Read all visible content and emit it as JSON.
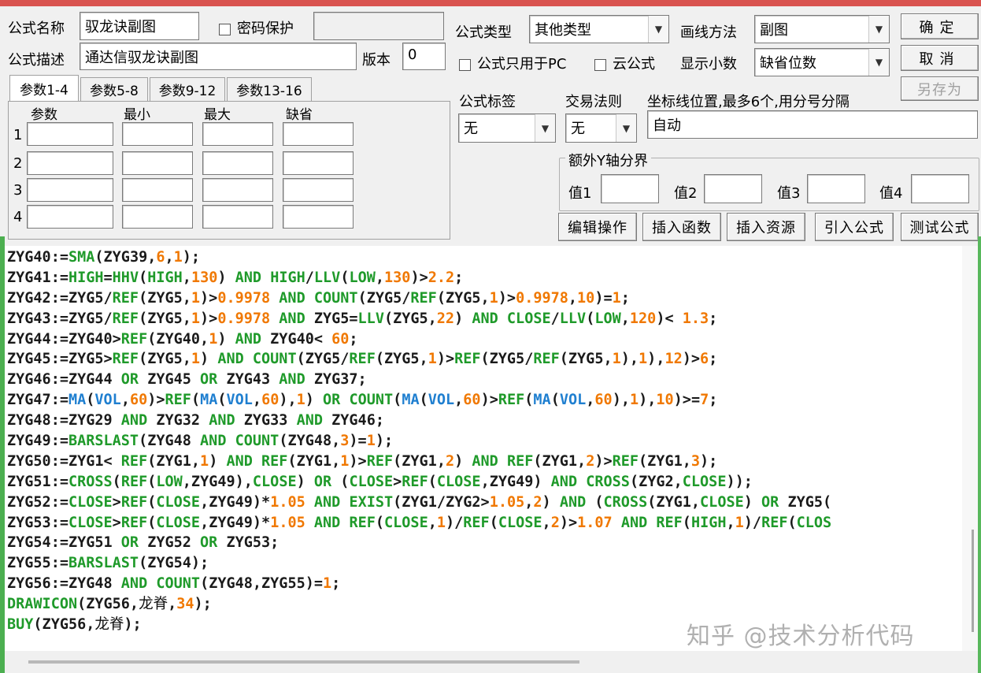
{
  "formula": {
    "name_label": "公式名称",
    "name_value": "驭龙诀副图",
    "password_label": "密码保护",
    "desc_label": "公式描述",
    "desc_value": "通达信驭龙诀副图",
    "version_label": "版本",
    "version_value": "0",
    "type_label": "公式类型",
    "type_value": "其他类型",
    "draw_label": "画线方法",
    "draw_value": "副图",
    "pc_only_label": "公式只用于PC",
    "cloud_label": "云公式",
    "decimals_label": "显示小数",
    "decimals_value": "缺省位数",
    "tag_label": "公式标签",
    "tag_value": "无",
    "rule_label": "交易法则",
    "rule_value": "无",
    "axis_label": "坐标线位置,最多6个,用分号分隔",
    "axis_value": "自动",
    "extra_y_label": "额外Y轴分界",
    "val1": "值1",
    "val2": "值2",
    "val3": "值3",
    "val4": "值4"
  },
  "buttons": {
    "ok": "确定",
    "cancel": "取消",
    "save_as": "另存为",
    "edit_ops": "编辑操作",
    "insert_fn": "插入函数",
    "insert_res": "插入资源",
    "import": "引入公式",
    "test": "测试公式"
  },
  "tabs": [
    "参数1-4",
    "参数5-8",
    "参数9-12",
    "参数13-16"
  ],
  "params": {
    "headers": [
      "参数",
      "最小",
      "最大",
      "缺省"
    ],
    "rows": [
      "1",
      "2",
      "3",
      "4"
    ]
  },
  "code_lines": [
    [
      [
        "t",
        "ZYG40:="
      ],
      [
        "f",
        "SMA"
      ],
      [
        "t",
        "(ZYG39,"
      ],
      [
        "n",
        "6"
      ],
      [
        "t",
        ","
      ],
      [
        "n",
        "1"
      ],
      [
        "t",
        ");"
      ]
    ],
    [
      [
        "t",
        "ZYG41:="
      ],
      [
        "f",
        "HIGH"
      ],
      [
        "t",
        "="
      ],
      [
        "f",
        "HHV"
      ],
      [
        "t",
        "("
      ],
      [
        "f",
        "HIGH"
      ],
      [
        "t",
        ","
      ],
      [
        "n",
        "130"
      ],
      [
        "t",
        ") "
      ],
      [
        "f",
        "AND"
      ],
      [
        "t",
        " "
      ],
      [
        "f",
        "HIGH"
      ],
      [
        "t",
        "/"
      ],
      [
        "f",
        "LLV"
      ],
      [
        "t",
        "("
      ],
      [
        "f",
        "LOW"
      ],
      [
        "t",
        ","
      ],
      [
        "n",
        "130"
      ],
      [
        "t",
        ")>"
      ],
      [
        "n",
        "2.2"
      ],
      [
        "t",
        ";"
      ]
    ],
    [
      [
        "t",
        "ZYG42:=ZYG5/"
      ],
      [
        "f",
        "REF"
      ],
      [
        "t",
        "(ZYG5,"
      ],
      [
        "n",
        "1"
      ],
      [
        "t",
        ")>"
      ],
      [
        "n",
        "0.9978"
      ],
      [
        "t",
        " "
      ],
      [
        "f",
        "AND"
      ],
      [
        "t",
        " "
      ],
      [
        "f",
        "COUNT"
      ],
      [
        "t",
        "(ZYG5/"
      ],
      [
        "f",
        "REF"
      ],
      [
        "t",
        "(ZYG5,"
      ],
      [
        "n",
        "1"
      ],
      [
        "t",
        ")>"
      ],
      [
        "n",
        "0.9978"
      ],
      [
        "t",
        ","
      ],
      [
        "n",
        "10"
      ],
      [
        "t",
        ")="
      ],
      [
        "n",
        "1"
      ],
      [
        "t",
        ";"
      ]
    ],
    [
      [
        "t",
        "ZYG43:=ZYG5/"
      ],
      [
        "f",
        "REF"
      ],
      [
        "t",
        "(ZYG5,"
      ],
      [
        "n",
        "1"
      ],
      [
        "t",
        ")>"
      ],
      [
        "n",
        "0.9978"
      ],
      [
        "t",
        " "
      ],
      [
        "f",
        "AND"
      ],
      [
        "t",
        " ZYG5="
      ],
      [
        "f",
        "LLV"
      ],
      [
        "t",
        "(ZYG5,"
      ],
      [
        "n",
        "22"
      ],
      [
        "t",
        ") "
      ],
      [
        "f",
        "AND"
      ],
      [
        "t",
        " "
      ],
      [
        "f",
        "CLOSE"
      ],
      [
        "t",
        "/"
      ],
      [
        "f",
        "LLV"
      ],
      [
        "t",
        "("
      ],
      [
        "f",
        "LOW"
      ],
      [
        "t",
        ","
      ],
      [
        "n",
        "120"
      ],
      [
        "t",
        ")< "
      ],
      [
        "n",
        "1.3"
      ],
      [
        "t",
        ";"
      ]
    ],
    [
      [
        "t",
        "ZYG44:=ZYG40>"
      ],
      [
        "f",
        "REF"
      ],
      [
        "t",
        "(ZYG40,"
      ],
      [
        "n",
        "1"
      ],
      [
        "t",
        ") "
      ],
      [
        "f",
        "AND"
      ],
      [
        "t",
        " ZYG40< "
      ],
      [
        "n",
        "60"
      ],
      [
        "t",
        ";"
      ]
    ],
    [
      [
        "t",
        "ZYG45:=ZYG5>"
      ],
      [
        "f",
        "REF"
      ],
      [
        "t",
        "(ZYG5,"
      ],
      [
        "n",
        "1"
      ],
      [
        "t",
        ") "
      ],
      [
        "f",
        "AND"
      ],
      [
        "t",
        " "
      ],
      [
        "f",
        "COUNT"
      ],
      [
        "t",
        "(ZYG5/"
      ],
      [
        "f",
        "REF"
      ],
      [
        "t",
        "(ZYG5,"
      ],
      [
        "n",
        "1"
      ],
      [
        "t",
        ")>"
      ],
      [
        "f",
        "REF"
      ],
      [
        "t",
        "(ZYG5/"
      ],
      [
        "f",
        "REF"
      ],
      [
        "t",
        "(ZYG5,"
      ],
      [
        "n",
        "1"
      ],
      [
        "t",
        "),"
      ],
      [
        "n",
        "1"
      ],
      [
        "t",
        "),"
      ],
      [
        "n",
        "12"
      ],
      [
        "t",
        ")>"
      ],
      [
        "n",
        "6"
      ],
      [
        "t",
        ";"
      ]
    ],
    [
      [
        "t",
        "ZYG46:=ZYG44 "
      ],
      [
        "f",
        "OR"
      ],
      [
        "t",
        " ZYG45 "
      ],
      [
        "f",
        "OR"
      ],
      [
        "t",
        " ZYG43 "
      ],
      [
        "f",
        "AND"
      ],
      [
        "t",
        " ZYG37;"
      ]
    ],
    [
      [
        "t",
        "ZYG47:="
      ],
      [
        "b",
        "MA"
      ],
      [
        "t",
        "("
      ],
      [
        "b",
        "VOL"
      ],
      [
        "t",
        ","
      ],
      [
        "n",
        "60"
      ],
      [
        "t",
        ")>"
      ],
      [
        "f",
        "REF"
      ],
      [
        "t",
        "("
      ],
      [
        "b",
        "MA"
      ],
      [
        "t",
        "("
      ],
      [
        "b",
        "VOL"
      ],
      [
        "t",
        ","
      ],
      [
        "n",
        "60"
      ],
      [
        "t",
        "),"
      ],
      [
        "n",
        "1"
      ],
      [
        "t",
        ") "
      ],
      [
        "f",
        "OR"
      ],
      [
        "t",
        " "
      ],
      [
        "f",
        "COUNT"
      ],
      [
        "t",
        "("
      ],
      [
        "b",
        "MA"
      ],
      [
        "t",
        "("
      ],
      [
        "b",
        "VOL"
      ],
      [
        "t",
        ","
      ],
      [
        "n",
        "60"
      ],
      [
        "t",
        ")>"
      ],
      [
        "f",
        "REF"
      ],
      [
        "t",
        "("
      ],
      [
        "b",
        "MA"
      ],
      [
        "t",
        "("
      ],
      [
        "b",
        "VOL"
      ],
      [
        "t",
        ","
      ],
      [
        "n",
        "60"
      ],
      [
        "t",
        "),"
      ],
      [
        "n",
        "1"
      ],
      [
        "t",
        "),"
      ],
      [
        "n",
        "10"
      ],
      [
        "t",
        ")>="
      ],
      [
        "n",
        "7"
      ],
      [
        "t",
        ";"
      ]
    ],
    [
      [
        "t",
        "ZYG48:=ZYG29 "
      ],
      [
        "f",
        "AND"
      ],
      [
        "t",
        " ZYG32 "
      ],
      [
        "f",
        "AND"
      ],
      [
        "t",
        " ZYG33 "
      ],
      [
        "f",
        "AND"
      ],
      [
        "t",
        " ZYG46;"
      ]
    ],
    [
      [
        "t",
        "ZYG49:="
      ],
      [
        "f",
        "BARSLAST"
      ],
      [
        "t",
        "(ZYG48 "
      ],
      [
        "f",
        "AND"
      ],
      [
        "t",
        " "
      ],
      [
        "f",
        "COUNT"
      ],
      [
        "t",
        "(ZYG48,"
      ],
      [
        "n",
        "3"
      ],
      [
        "t",
        ")="
      ],
      [
        "n",
        "1"
      ],
      [
        "t",
        ");"
      ]
    ],
    [
      [
        "t",
        "ZYG50:=ZYG1< "
      ],
      [
        "f",
        "REF"
      ],
      [
        "t",
        "(ZYG1,"
      ],
      [
        "n",
        "1"
      ],
      [
        "t",
        ") "
      ],
      [
        "f",
        "AND"
      ],
      [
        "t",
        " "
      ],
      [
        "f",
        "REF"
      ],
      [
        "t",
        "(ZYG1,"
      ],
      [
        "n",
        "1"
      ],
      [
        "t",
        ")>"
      ],
      [
        "f",
        "REF"
      ],
      [
        "t",
        "(ZYG1,"
      ],
      [
        "n",
        "2"
      ],
      [
        "t",
        ") "
      ],
      [
        "f",
        "AND"
      ],
      [
        "t",
        " "
      ],
      [
        "f",
        "REF"
      ],
      [
        "t",
        "(ZYG1,"
      ],
      [
        "n",
        "2"
      ],
      [
        "t",
        ")>"
      ],
      [
        "f",
        "REF"
      ],
      [
        "t",
        "(ZYG1,"
      ],
      [
        "n",
        "3"
      ],
      [
        "t",
        ");"
      ]
    ],
    [
      [
        "t",
        "ZYG51:="
      ],
      [
        "f",
        "CROSS"
      ],
      [
        "t",
        "("
      ],
      [
        "f",
        "REF"
      ],
      [
        "t",
        "("
      ],
      [
        "f",
        "LOW"
      ],
      [
        "t",
        ",ZYG49),"
      ],
      [
        "f",
        "CLOSE"
      ],
      [
        "t",
        ") "
      ],
      [
        "f",
        "OR"
      ],
      [
        "t",
        " ("
      ],
      [
        "f",
        "CLOSE"
      ],
      [
        "t",
        ">"
      ],
      [
        "f",
        "REF"
      ],
      [
        "t",
        "("
      ],
      [
        "f",
        "CLOSE"
      ],
      [
        "t",
        ",ZYG49) "
      ],
      [
        "f",
        "AND"
      ],
      [
        "t",
        " "
      ],
      [
        "f",
        "CROSS"
      ],
      [
        "t",
        "(ZYG2,"
      ],
      [
        "f",
        "CLOSE"
      ],
      [
        "t",
        "));"
      ]
    ],
    [
      [
        "t",
        "ZYG52:="
      ],
      [
        "f",
        "CLOSE"
      ],
      [
        "t",
        ">"
      ],
      [
        "f",
        "REF"
      ],
      [
        "t",
        "("
      ],
      [
        "f",
        "CLOSE"
      ],
      [
        "t",
        ",ZYG49)*"
      ],
      [
        "n",
        "1.05"
      ],
      [
        "t",
        " "
      ],
      [
        "f",
        "AND"
      ],
      [
        "t",
        " "
      ],
      [
        "f",
        "EXIST"
      ],
      [
        "t",
        "(ZYG1/ZYG2>"
      ],
      [
        "n",
        "1.05"
      ],
      [
        "t",
        ","
      ],
      [
        "n",
        "2"
      ],
      [
        "t",
        ") "
      ],
      [
        "f",
        "AND"
      ],
      [
        "t",
        " ("
      ],
      [
        "f",
        "CROSS"
      ],
      [
        "t",
        "(ZYG1,"
      ],
      [
        "f",
        "CLOSE"
      ],
      [
        "t",
        ") "
      ],
      [
        "f",
        "OR"
      ],
      [
        "t",
        " ZYG5("
      ]
    ],
    [
      [
        "t",
        "ZYG53:="
      ],
      [
        "f",
        "CLOSE"
      ],
      [
        "t",
        ">"
      ],
      [
        "f",
        "REF"
      ],
      [
        "t",
        "("
      ],
      [
        "f",
        "CLOSE"
      ],
      [
        "t",
        ",ZYG49)*"
      ],
      [
        "n",
        "1.05"
      ],
      [
        "t",
        " "
      ],
      [
        "f",
        "AND"
      ],
      [
        "t",
        " "
      ],
      [
        "f",
        "REF"
      ],
      [
        "t",
        "("
      ],
      [
        "f",
        "CLOSE"
      ],
      [
        "t",
        ","
      ],
      [
        "n",
        "1"
      ],
      [
        "t",
        ")/"
      ],
      [
        "f",
        "REF"
      ],
      [
        "t",
        "("
      ],
      [
        "f",
        "CLOSE"
      ],
      [
        "t",
        ","
      ],
      [
        "n",
        "2"
      ],
      [
        "t",
        ")>"
      ],
      [
        "n",
        "1.07"
      ],
      [
        "t",
        " "
      ],
      [
        "f",
        "AND"
      ],
      [
        "t",
        " "
      ],
      [
        "f",
        "REF"
      ],
      [
        "t",
        "("
      ],
      [
        "f",
        "HIGH"
      ],
      [
        "t",
        ","
      ],
      [
        "n",
        "1"
      ],
      [
        "t",
        ")/"
      ],
      [
        "f",
        "REF"
      ],
      [
        "t",
        "("
      ],
      [
        "f",
        "CLOS"
      ]
    ],
    [
      [
        "t",
        "ZYG54:=ZYG51 "
      ],
      [
        "f",
        "OR"
      ],
      [
        "t",
        " ZYG52 "
      ],
      [
        "f",
        "OR"
      ],
      [
        "t",
        " ZYG53;"
      ]
    ],
    [
      [
        "t",
        "ZYG55:="
      ],
      [
        "f",
        "BARSLAST"
      ],
      [
        "t",
        "(ZYG54);"
      ]
    ],
    [
      [
        "t",
        "ZYG56:=ZYG48 "
      ],
      [
        "f",
        "AND"
      ],
      [
        "t",
        " "
      ],
      [
        "f",
        "COUNT"
      ],
      [
        "t",
        "(ZYG48,ZYG55)="
      ],
      [
        "n",
        "1"
      ],
      [
        "t",
        ";"
      ]
    ],
    [
      [
        "f",
        "DRAWICON"
      ],
      [
        "t",
        "(ZYG56,"
      ],
      [
        "c",
        "龙脊"
      ],
      [
        "t",
        ","
      ],
      [
        "n",
        "34"
      ],
      [
        "t",
        ");"
      ]
    ],
    [
      [
        "f",
        "BUY"
      ],
      [
        "t",
        "(ZYG56,"
      ],
      [
        "c",
        "龙脊"
      ],
      [
        "t",
        ");"
      ]
    ]
  ],
  "watermark": "知乎 @技术分析代码",
  "colors": {
    "function": "#1f9a2a",
    "number": "#f07800",
    "builtin_blue": "#1f7fd0",
    "title_bar": "#d9534f"
  }
}
